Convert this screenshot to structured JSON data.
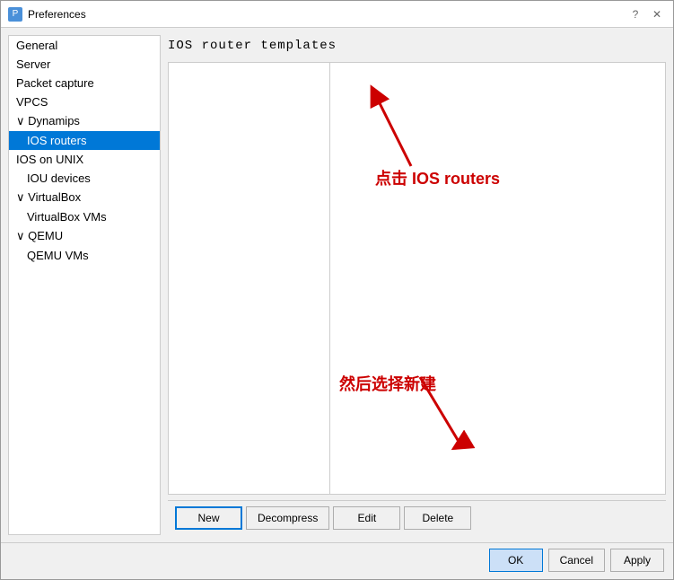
{
  "window": {
    "title": "Preferences",
    "icon": "P",
    "help_btn": "?",
    "close_btn": "✕"
  },
  "sidebar": {
    "items": [
      {
        "id": "general",
        "label": "General",
        "indent": 0,
        "selected": false
      },
      {
        "id": "server",
        "label": "Server",
        "indent": 0,
        "selected": false
      },
      {
        "id": "packet-capture",
        "label": "Packet capture",
        "indent": 0,
        "selected": false
      },
      {
        "id": "vpcs",
        "label": "VPCS",
        "indent": 0,
        "selected": false
      },
      {
        "id": "dynamips",
        "label": "∨ Dynamips",
        "indent": 0,
        "selected": false
      },
      {
        "id": "ios-routers",
        "label": "IOS routers",
        "indent": 1,
        "selected": true
      },
      {
        "id": "ios-on-unix",
        "label": "IOS on UNIX",
        "indent": 0,
        "selected": false
      },
      {
        "id": "iou-devices",
        "label": "IOU devices",
        "indent": 1,
        "selected": false
      },
      {
        "id": "virtualbox",
        "label": "∨ VirtualBox",
        "indent": 0,
        "selected": false
      },
      {
        "id": "virtualbox-vms",
        "label": "VirtualBox VMs",
        "indent": 1,
        "selected": false
      },
      {
        "id": "qemu",
        "label": "∨ QEMU",
        "indent": 0,
        "selected": false
      },
      {
        "id": "qemu-vms",
        "label": "QEMU VMs",
        "indent": 1,
        "selected": false
      }
    ]
  },
  "main": {
    "panel_title": "IOS router templates",
    "annotations": {
      "click_label": "点击 IOS routers",
      "new_label": "然后选择新建"
    }
  },
  "buttons": {
    "new": "New",
    "decompress": "Decompress",
    "edit": "Edit",
    "delete": "Delete"
  },
  "footer": {
    "ok": "OK",
    "cancel": "Cancel",
    "apply": "Apply"
  }
}
